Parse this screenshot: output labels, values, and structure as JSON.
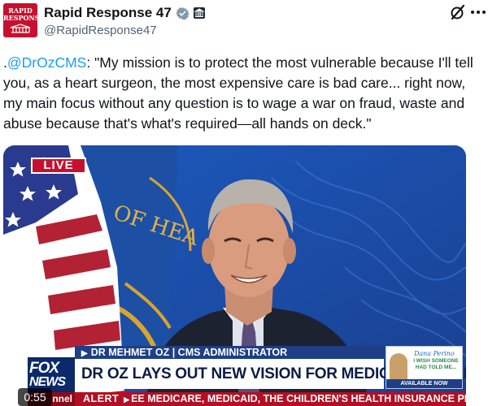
{
  "author": {
    "display_name": "Rapid Response 47",
    "handle": "@RapidResponse47",
    "avatar_text": [
      "RAPID",
      "RESPONSE"
    ],
    "icons": [
      "verified-badge-icon",
      "government-building-icon"
    ]
  },
  "header_actions": {
    "icons": [
      "grok-icon",
      "more-options-icon"
    ]
  },
  "tweet": {
    "prefix": ".",
    "mention": "@DrOzCMS",
    "body": ": \"My mission is to protect the most vulnerable because I'll tell you, as a heart surgeon, the most expensive care is bad care... right now, my main focus without any question is to wage a war on fraud, waste and abuse because that's what's required—all hands on deck.\""
  },
  "video": {
    "live_label": "LIVE",
    "seal_text": "OF HEA",
    "chyron_name": "DR MEHMET OZ | CMS ADMINISTRATOR",
    "chyron_headline": "DR OZ LAYS OUT NEW VISION FOR MEDICARE & MEDICAID",
    "logo_top": "FOX",
    "logo_bottom": "NEWS",
    "channel_label": "nnel",
    "alert_label": "ALERT",
    "alert_text": "EE MEDICARE, MEDICAID, THE CHILDREN'S HEALTH INSURANCE PROGRAM AND",
    "promo": {
      "name": "Dana Perino",
      "tagline": "I WISH SOMEONE HAD TOLD ME...",
      "available": "AVAILABLE NOW"
    },
    "timestamp": "0:55"
  },
  "colors": {
    "accent": "#1d9bf0",
    "text": "#0f1419",
    "secondary_text": "#536471",
    "fox_red": "#c8102e",
    "fox_blue": "#1e3f86"
  }
}
